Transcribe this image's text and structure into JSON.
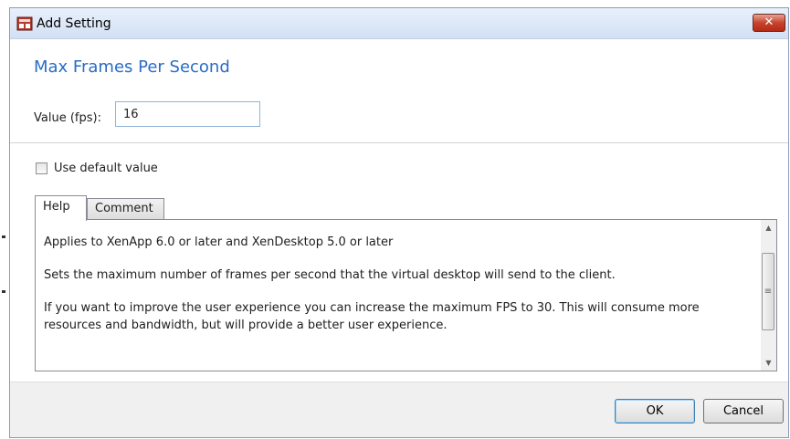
{
  "window": {
    "title": "Add Setting",
    "close_glyph": "✕"
  },
  "setting": {
    "heading": "Max Frames Per Second",
    "value_label": "Value (fps):",
    "value": "16",
    "use_default_label": "Use default value",
    "use_default_checked": false
  },
  "tabs": [
    {
      "label": "Help",
      "active": true
    },
    {
      "label": "Comment",
      "active": false
    }
  ],
  "help": {
    "paragraphs": [
      "Applies to XenApp 6.0 or later and XenDesktop 5.0 or later",
      "Sets the maximum number of frames per second that the virtual desktop will send to the client.",
      "If you want to improve the user experience you can increase the maximum FPS to 30. This will consume more resources and bandwidth, but will provide a better user experience."
    ]
  },
  "buttons": {
    "ok": "OK",
    "cancel": "Cancel"
  },
  "icons": [
    "app-settings-icon",
    "close-icon",
    "scroll-up-arrow-icon",
    "scroll-down-arrow-icon"
  ],
  "colors": {
    "heading": "#2a6cc4",
    "close_button": "#c7432d",
    "title_bar": "#dbe6f6"
  }
}
